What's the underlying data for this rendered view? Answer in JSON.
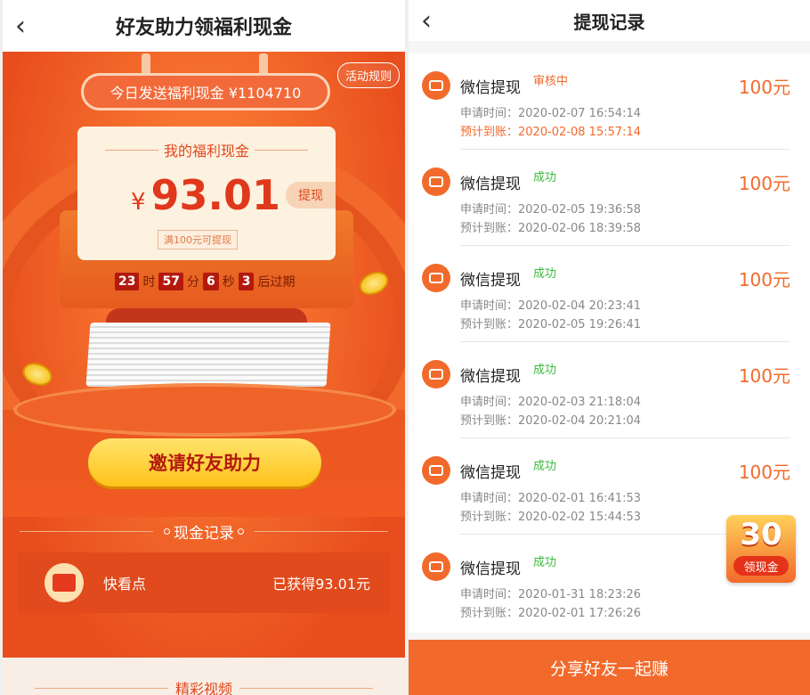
{
  "left": {
    "header": {
      "back_icon": "‹",
      "title": "好友助力领福利现金"
    },
    "banner_text": "今日发送福利现金 ¥1104710",
    "rules_label": "活动规则",
    "card": {
      "label": "我的福利现金",
      "currency": "¥",
      "amount": "93.01",
      "withdraw_label": "提现",
      "hint": "满100元可提现"
    },
    "countdown": {
      "hours": "23",
      "h_unit": "时",
      "minutes": "57",
      "m_unit": "分",
      "seconds": "6",
      "s_unit": "秒",
      "tenths": "3",
      "suffix": "后过期"
    },
    "invite_button": "邀请好友助力",
    "cash_section_title": "现金记录",
    "cash_record": {
      "name": "快看点",
      "earned": "已获得93.01元"
    },
    "bottom_section_title": "精彩视频"
  },
  "right": {
    "header": {
      "back_icon": "‹",
      "title": "提现记录"
    },
    "items": [
      {
        "label": "微信提现",
        "status": "审核中",
        "status_color": "#f26a2b",
        "amount": "100元",
        "apply": "申请时间：2020-02-07 16:54:14",
        "expect": "预计到账：2020-02-08 15:57:14",
        "expect_color": "#f26a2b"
      },
      {
        "label": "微信提现",
        "status": "成功",
        "status_color": "#3dbb3d",
        "amount": "100元",
        "apply": "申请时间：2020-02-05 19:36:58",
        "expect": "预计到账：2020-02-06 18:39:58",
        "expect_color": "#888888"
      },
      {
        "label": "微信提现",
        "status": "成功",
        "status_color": "#3dbb3d",
        "amount": "100元",
        "apply": "申请时间：2020-02-04 20:23:41",
        "expect": "预计到账：2020-02-05 19:26:41",
        "expect_color": "#888888"
      },
      {
        "label": "微信提现",
        "status": "成功",
        "status_color": "#3dbb3d",
        "amount": "100元",
        "apply": "申请时间：2020-02-03 21:18:04",
        "expect": "预计到账：2020-02-04 20:21:04",
        "expect_color": "#888888"
      },
      {
        "label": "微信提现",
        "status": "成功",
        "status_color": "#3dbb3d",
        "amount": "100元",
        "apply": "申请时间：2020-02-01 16:41:53",
        "expect": "预计到账：2020-02-02 15:44:53",
        "expect_color": "#888888"
      },
      {
        "label": "微信提现",
        "status": "成功",
        "status_color": "#3dbb3d",
        "amount": "",
        "apply": "申请时间：2020-01-31 18:23:26",
        "expect": "预计到账：2020-02-01 17:26:26",
        "expect_color": "#888888"
      }
    ],
    "badge": {
      "number": "30",
      "text": "领现金"
    },
    "share_button": "分享好友一起赚"
  },
  "colors": {
    "accent": "#f26a2b",
    "success": "#3dbb3d",
    "gold": "#ffc21a"
  },
  "icons": {
    "back": "chevron-left-icon",
    "wallet": "wallet-icon",
    "coin": "coin-icon"
  }
}
